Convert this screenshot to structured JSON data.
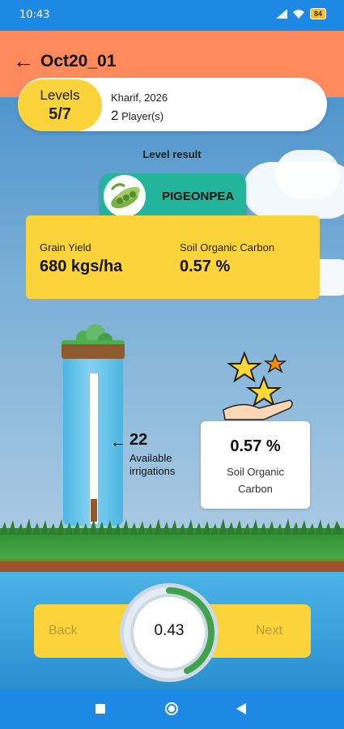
{
  "status_bar": {
    "time": "10:43",
    "battery": "84"
  },
  "header": {
    "title": "Oct20_01"
  },
  "level": {
    "label": "Levels",
    "value": "5/7",
    "season": "Kharif, 2026",
    "players_count": "2",
    "players_label": "Player(s)"
  },
  "level_result_label": "Level result",
  "crop": {
    "name": "PIGEONPEA"
  },
  "results": {
    "grain_yield_label": "Grain Yield",
    "grain_yield_value": "680 kgs/ha",
    "soc_label": "Soil Organic Carbon",
    "soc_value": "0.57 %"
  },
  "irrigation": {
    "count": "22",
    "label_line1": "Available",
    "label_line2": "irrigations"
  },
  "soc_card": {
    "value": "0.57 %",
    "label_line1": "Soil Organic",
    "label_line2": "Carbon"
  },
  "controls": {
    "back_label": "Back",
    "next_label": "Next",
    "dial_value": "0.43",
    "dial_progress": 0.43
  },
  "colors": {
    "header": "#ff8a5c",
    "accent_yellow": "#fbd33a",
    "crop_teal": "#22b59c",
    "status_blue": "#1e88e5"
  }
}
